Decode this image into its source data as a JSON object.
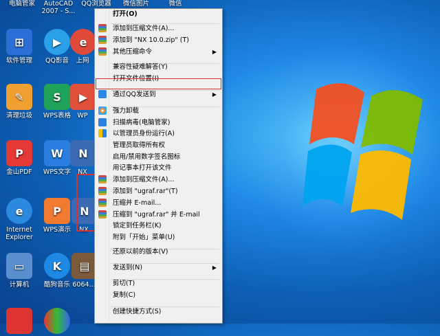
{
  "desktop_top_labels": [
    "电脑管家",
    "AutoCAD 2007 - S...",
    "QQ浏览器",
    "微信图片_2017...",
    "微信"
  ],
  "desktop_icons": [
    {
      "label": "软件管理",
      "icon": "software-manager-icon",
      "color": "#2b6fd6"
    },
    {
      "label": "QQ影音",
      "icon": "qq-player-icon",
      "color": "#2aa0e8"
    },
    {
      "label": "上网",
      "icon": "browser-icon",
      "color": "#e04a3a"
    },
    {
      "label": "清理垃圾",
      "icon": "clean-trash-icon",
      "color": "#f0a030"
    },
    {
      "label": "WPS表格",
      "icon": "wps-spreadsheet-icon",
      "color": "#1fa35a"
    },
    {
      "label": "WP",
      "icon": "wps-presentation-icon",
      "color": "#e0503a"
    },
    {
      "label": "金山PDF",
      "icon": "kingsoft-pdf-icon",
      "color": "#e53935"
    },
    {
      "label": "WPS文字",
      "icon": "wps-writer-icon",
      "color": "#2b7de0"
    },
    {
      "label": "NX",
      "icon": "nx-icon",
      "color": "#3b6bb5"
    },
    {
      "label": "Internet Explorer",
      "icon": "internet-explorer-icon",
      "color": "#2b8ae0"
    },
    {
      "label": "WPS演示",
      "icon": "wps-slides-icon",
      "color": "#f07a30"
    },
    {
      "label": "NX",
      "icon": "nx-selected-icon",
      "color": "#3b6bb5"
    },
    {
      "label": "计算机",
      "icon": "computer-icon",
      "color": "#5a8fcf"
    },
    {
      "label": "酷狗音乐",
      "icon": "kugou-music-icon",
      "color": "#1e88e5"
    },
    {
      "label": "6064...",
      "icon": "file-icon",
      "color": "#7a5a3a"
    }
  ],
  "context_menu": {
    "items": [
      {
        "label": "打开(O)",
        "bold": true,
        "icon": "",
        "submenu": false
      },
      {
        "label": "sep"
      },
      {
        "label": "添加到压缩文件(A)...",
        "icon": "rar-icon",
        "submenu": false
      },
      {
        "label": "添加到 \"NX 10.0.zip\" (T)",
        "icon": "rar-icon",
        "submenu": false
      },
      {
        "label": "其他压缩命令",
        "icon": "rar-icon",
        "submenu": true
      },
      {
        "label": "sep"
      },
      {
        "label": "兼容性疑难解答(Y)",
        "icon": "",
        "submenu": false
      },
      {
        "label": "打开文件位置(I)",
        "icon": "",
        "submenu": false,
        "highlighted": true
      },
      {
        "label": "sep"
      },
      {
        "label": "通过QQ发送到",
        "icon": "qq-icon",
        "submenu": true
      },
      {
        "label": "sep"
      },
      {
        "label": "强力卸载",
        "icon": "flower-icon",
        "submenu": false
      },
      {
        "label": "扫描病毒(电脑管家)",
        "icon": "shield-icon",
        "submenu": false
      },
      {
        "label": "以管理员身份运行(A)",
        "icon": "uac-shield-icon",
        "submenu": false
      },
      {
        "label": "管理员取得所有权",
        "icon": "",
        "submenu": false
      },
      {
        "label": "启用/禁用数字签名图标",
        "icon": "",
        "submenu": false
      },
      {
        "label": "用记事本打开该文件",
        "icon": "",
        "submenu": false
      },
      {
        "label": "添加到压缩文件(A)...",
        "icon": "rar-icon",
        "submenu": false
      },
      {
        "label": "添加到 \"ugraf.rar\"(T)",
        "icon": "rar-icon",
        "submenu": false
      },
      {
        "label": "压缩并 E-mail...",
        "icon": "rar-icon",
        "submenu": false
      },
      {
        "label": "压缩到 \"ugraf.rar\" 并 E-mail",
        "icon": "rar-icon",
        "submenu": false
      },
      {
        "label": "锁定到任务栏(K)",
        "icon": "",
        "submenu": false
      },
      {
        "label": "附到「开始」菜单(U)",
        "icon": "",
        "submenu": false
      },
      {
        "label": "sep"
      },
      {
        "label": "还原以前的版本(V)",
        "icon": "",
        "submenu": false
      },
      {
        "label": "sep"
      },
      {
        "label": "发送到(N)",
        "icon": "",
        "submenu": true
      },
      {
        "label": "sep"
      },
      {
        "label": "剪切(T)",
        "icon": "",
        "submenu": false
      },
      {
        "label": "复制(C)",
        "icon": "",
        "submenu": false
      },
      {
        "label": "sep"
      },
      {
        "label": "创建快捷方式(S)",
        "icon": "",
        "submenu": false
      }
    ]
  }
}
